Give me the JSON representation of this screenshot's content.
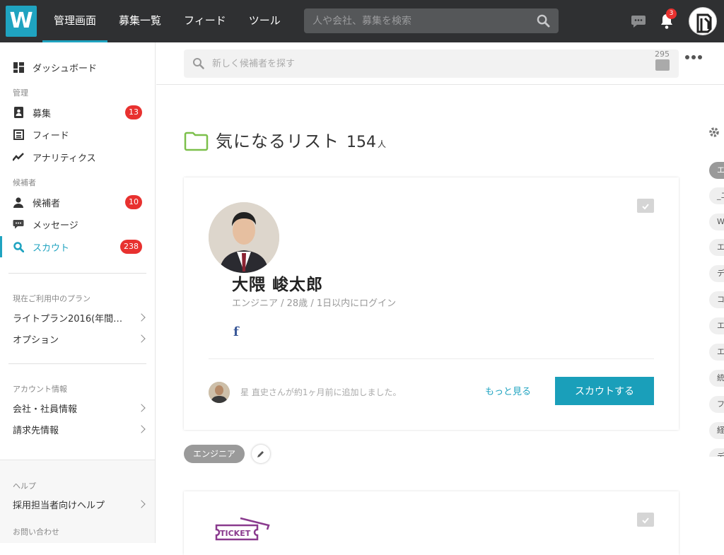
{
  "topbar": {
    "logo": "W",
    "nav": [
      "管理画面",
      "募集一覧",
      "フィード",
      "ツール"
    ],
    "search_placeholder": "人や会社、募集を検索",
    "notification_count": "3"
  },
  "sidebar": {
    "dashboard": "ダッシュボード",
    "section_manage": "管理",
    "manage_items": [
      {
        "label": "募集",
        "badge": "13"
      },
      {
        "label": "フィード",
        "badge": ""
      },
      {
        "label": "アナリティクス",
        "badge": ""
      }
    ],
    "section_candidates": "候補者",
    "candidate_items": [
      {
        "label": "候補者",
        "badge": "10"
      },
      {
        "label": "メッセージ",
        "badge": ""
      },
      {
        "label": "スカウト",
        "badge": "238"
      }
    ],
    "plan_heading": "現在ご利用中のプラン",
    "plan_items": [
      "ライトプラン2016(年間パ...",
      "オプション"
    ],
    "account_heading": "アカウント情報",
    "account_items": [
      "会社・社員情報",
      "請求先情報"
    ],
    "help_heading": "ヘルプ",
    "help_items": [
      "採用担当者向けヘルプ"
    ],
    "contact_heading": "お問い合わせ"
  },
  "subbar": {
    "search_placeholder": "新しく候補者を探す",
    "folder_count": "295"
  },
  "list": {
    "title": "気になるリスト",
    "count": "154",
    "unit": "人"
  },
  "candidate": {
    "name": "大隈 峻太郎",
    "meta": "エンジニア / 28歳 / 1日以内にログイン",
    "social": "f",
    "added_text": "星 直史さんが約1ヶ月前に追加しました。",
    "more_link": "もっと見る",
    "scout_button": "スカウトする",
    "tag": "エンジニア"
  },
  "second_card": {
    "logo_text": "TICKET"
  },
  "right_tags": [
    "エ",
    "_エ",
    "W",
    "エ",
    "デ",
    "コ",
    "エ",
    "エ",
    "統",
    "フ",
    "経",
    "デ"
  ]
}
